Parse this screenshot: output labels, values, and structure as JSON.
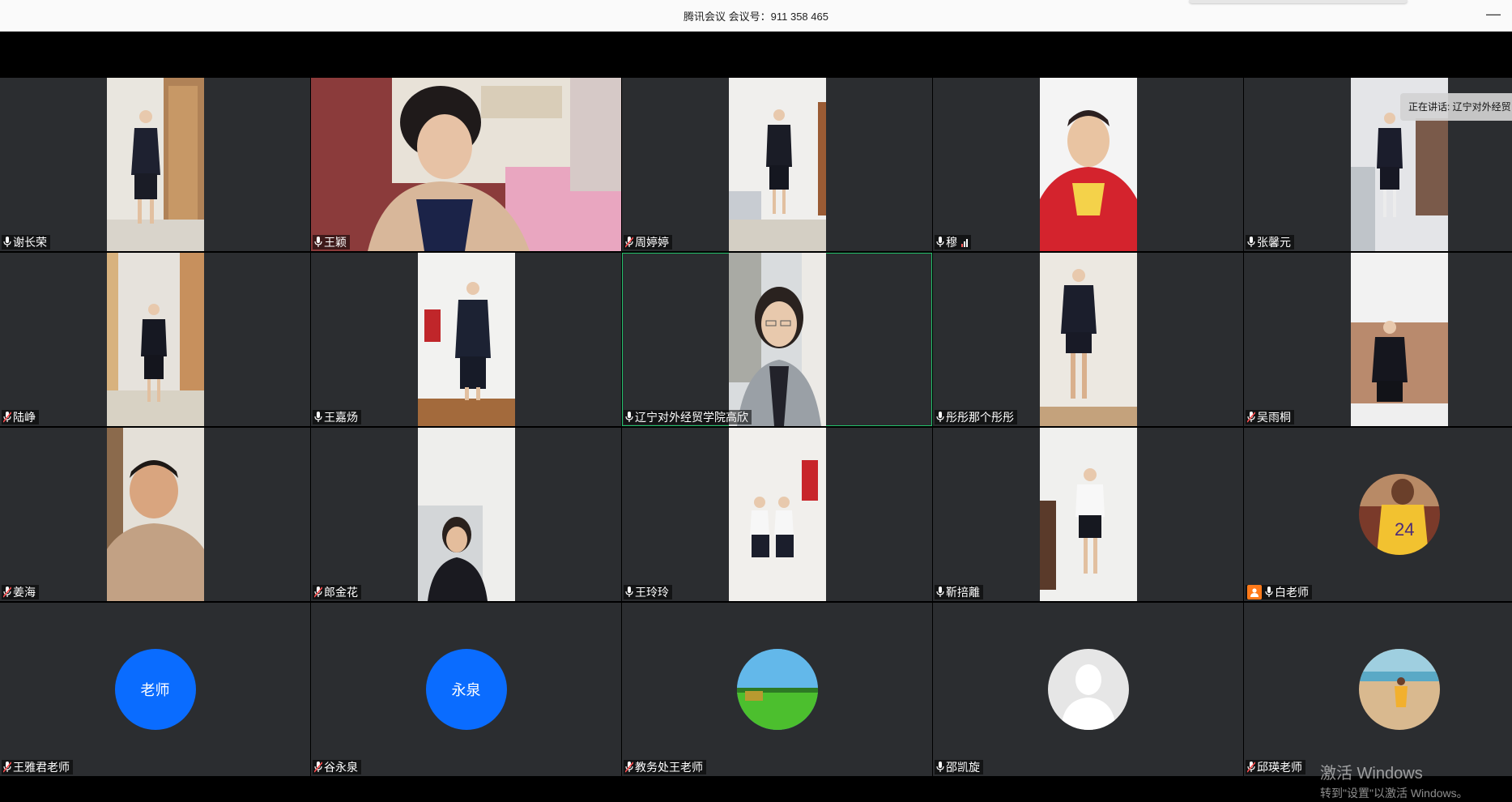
{
  "window": {
    "title": "腾讯会议 会议号：911 358 465",
    "minimize_symbol": "—"
  },
  "speaking_now": "正在讲话: 辽宁对外经贸",
  "watermark": {
    "line1": "激活 Windows",
    "line2": "转到\"设置\"以激活 Windows。"
  },
  "participants": [
    {
      "name": "谢长荣",
      "mic": "on"
    },
    {
      "name": "王颖",
      "mic": "on"
    },
    {
      "name": "周婷婷",
      "mic": "muted"
    },
    {
      "name": "穆",
      "mic": "on",
      "signal": "weak"
    },
    {
      "name": "张馨元",
      "mic": "on"
    },
    {
      "name": "陆峥",
      "mic": "muted"
    },
    {
      "name": "王嘉炀",
      "mic": "on"
    },
    {
      "name": "辽宁对外经贸学院高欣",
      "mic": "on",
      "active": true
    },
    {
      "name": "彤彤那个彤彤",
      "mic": "on"
    },
    {
      "name": "吴雨桐",
      "mic": "muted"
    },
    {
      "name": "姜海",
      "mic": "muted"
    },
    {
      "name": "郎金花",
      "mic": "muted"
    },
    {
      "name": "王玲玲",
      "mic": "on"
    },
    {
      "name": "靳掊離",
      "mic": "on"
    },
    {
      "name": "白老师",
      "mic": "on",
      "host": true
    },
    {
      "name": "王雅君老师",
      "mic": "muted",
      "avatar_text": "老师"
    },
    {
      "name": "谷永泉",
      "mic": "muted",
      "avatar_text": "永泉"
    },
    {
      "name": "教务处王老师",
      "mic": "muted"
    },
    {
      "name": "邵凯旋",
      "mic": "on"
    },
    {
      "name": "邱瑛老师",
      "mic": "muted"
    }
  ],
  "colors": {
    "tile_bg": "#2b2d30",
    "avatar_blue": "#0a6cff",
    "active_border": "#23c16b",
    "host_badge": "#ff7a1a"
  }
}
